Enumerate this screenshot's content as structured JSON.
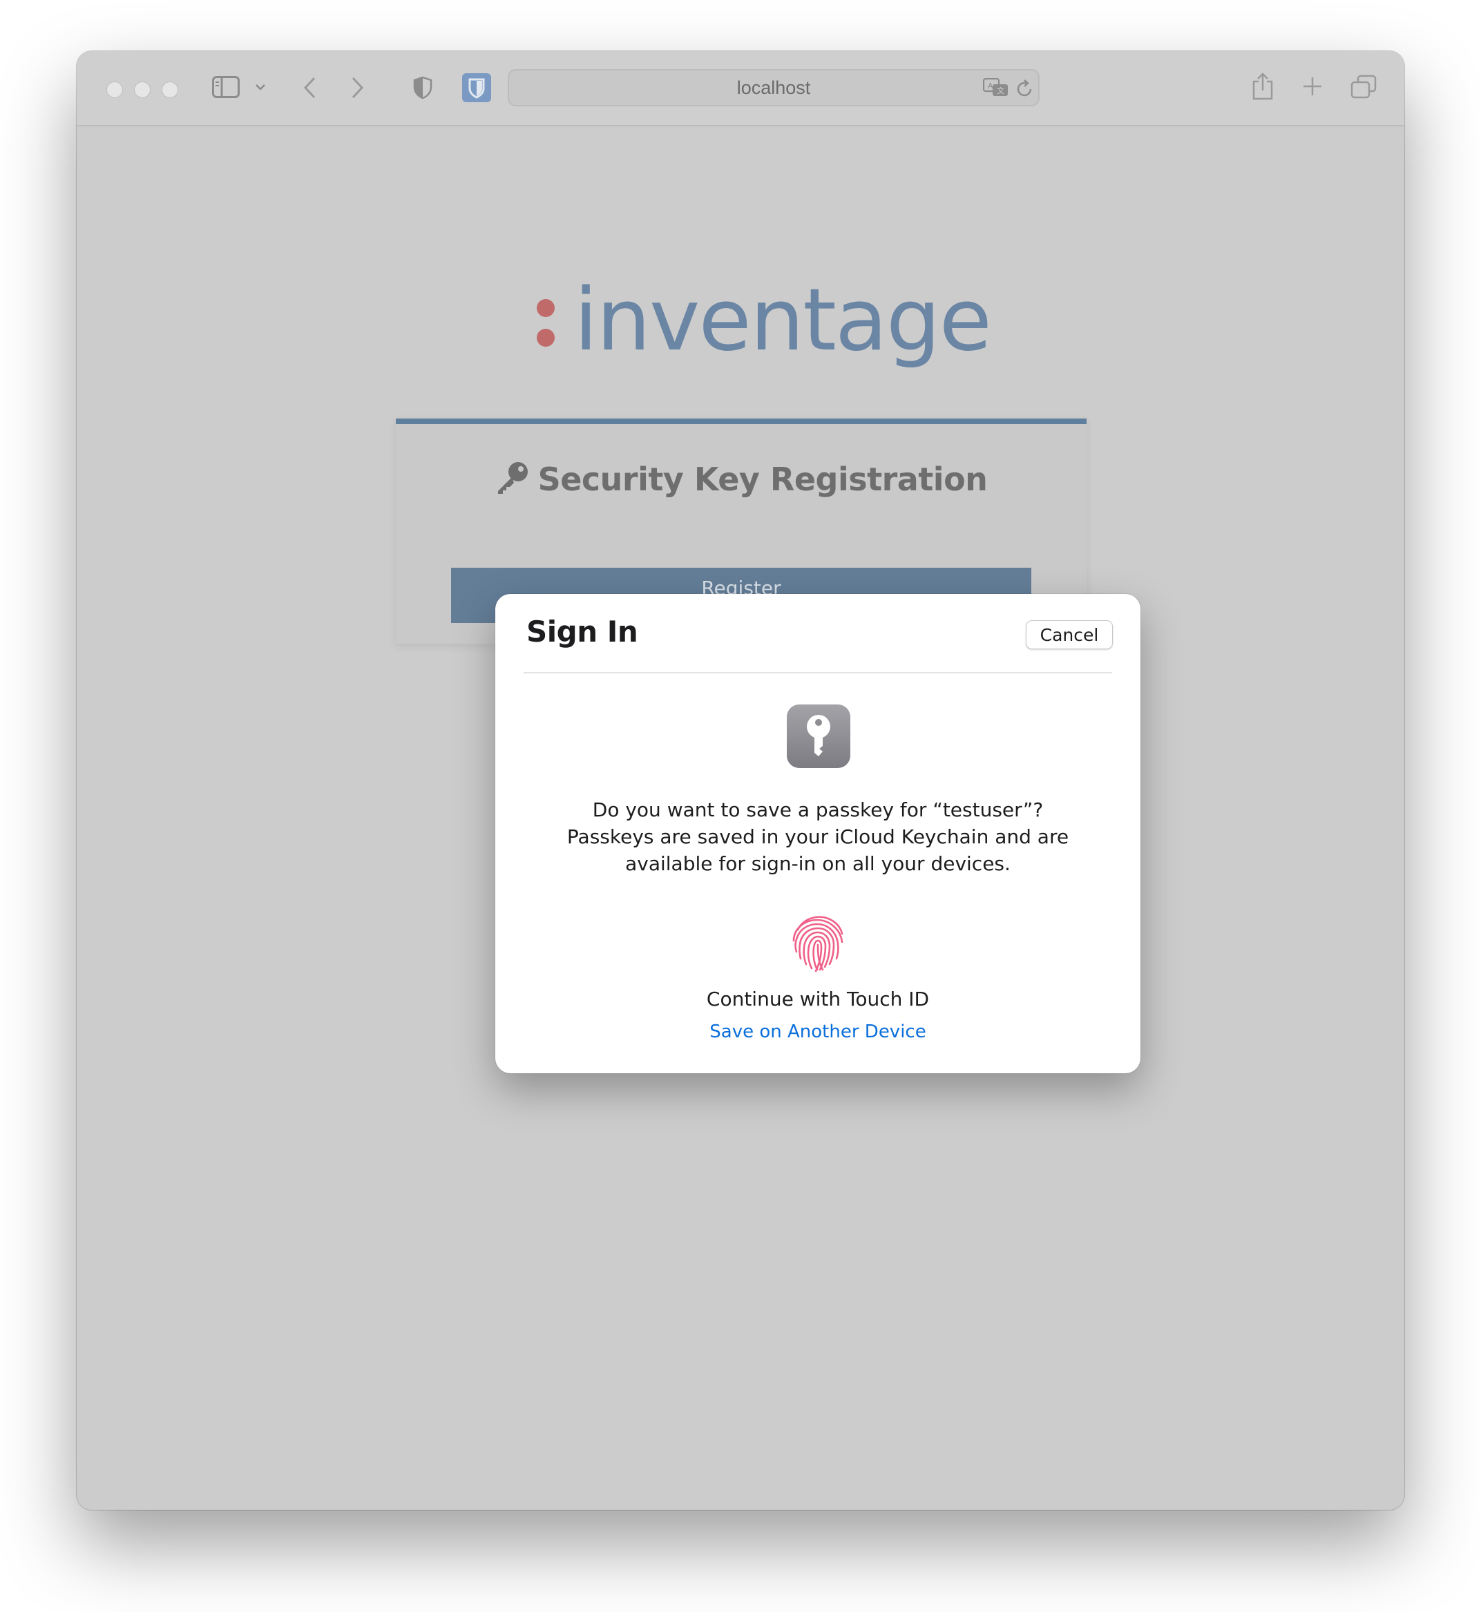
{
  "browser": {
    "address": "localhost"
  },
  "page": {
    "logo_text": "inventage",
    "card_title": "Security Key Registration",
    "register_label": "Register"
  },
  "dialog": {
    "title": "Sign In",
    "cancel_label": "Cancel",
    "message_lines": [
      "Do you want to save a passkey for “testuser”?",
      "Passkeys are saved in your iCloud Keychain and are",
      "available for sign-in on all your devices."
    ],
    "touch_id_label": "Continue with Touch ID",
    "another_device_label": "Save on Another Device"
  },
  "colors": {
    "brand_blue": "#6a86a4",
    "brand_dot": "#c06a6a",
    "link_blue": "#0a6fdc",
    "fingerprint": "#f06088"
  },
  "icons": {
    "window_controls": [
      "close-icon",
      "minimize-icon",
      "zoom-icon"
    ],
    "toolbar": [
      "sidebar-icon",
      "chevron-down-icon",
      "back-icon",
      "forward-icon",
      "privacy-shield-icon",
      "bitwarden-icon",
      "translate-icon",
      "reload-icon",
      "share-icon",
      "new-tab-icon",
      "tab-overview-icon"
    ],
    "dialog": [
      "passkey-icon",
      "fingerprint-icon"
    ]
  }
}
